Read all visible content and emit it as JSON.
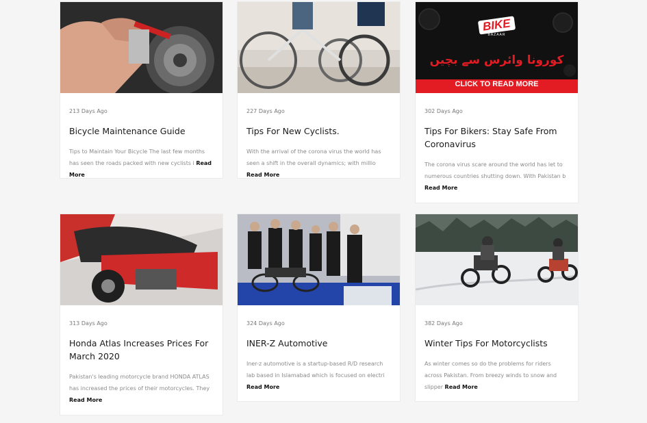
{
  "posts": [
    {
      "days_ago": "213 Days Ago",
      "title": "Bicycle Maintenance Guide",
      "excerpt": "Tips to Maintain Your Bicycle The last few months has seen the roads packed with new cyclists i",
      "read_more": "Read More",
      "image": "bicycle-maintenance-photo"
    },
    {
      "days_ago": "227 Days Ago",
      "title": "Tips For New Cyclists.",
      "excerpt": "With the arrival of the corona virus the world has seen a shift in the overall dynamics; with millio",
      "read_more": "Read More",
      "image": "new-cyclists-photo"
    },
    {
      "days_ago": "302 Days Ago",
      "title": "Tips For Bikers: Stay Safe From Coronavirus",
      "excerpt": "The corona virus scare around the world has let to numerous countries shutting down. With Pakistan b",
      "read_more": "Read More",
      "image": "bike-bazaar-corona-banner",
      "banner": {
        "brand": "BIKE",
        "sub": "BAZAAR",
        "urdu": "کورونا وائرس سے بچیں",
        "cta": "CLICK TO READ MORE"
      }
    },
    {
      "days_ago": "313 Days Ago",
      "title": "Honda Atlas Increases Prices For March 2020",
      "excerpt": "Pakistan's leading motorcycle brand HONDA ATLAS has increased the prices of their motorcycles. They",
      "read_more": "Read More",
      "image": "honda-motorcycle-photo"
    },
    {
      "days_ago": "324 Days Ago",
      "title": "INER-Z Automotive",
      "excerpt": "Iner-z automotive is a startup-based R/D research lab based in Islamabad which is focused on electri",
      "read_more": "Read More",
      "image": "iner-z-team-photo"
    },
    {
      "days_ago": "382 Days Ago",
      "title": "Winter Tips For Motorcyclists",
      "excerpt": "As winter comes so do the problems for riders across Pakistan. From breezy winds to snow and slipper",
      "read_more": "Read More",
      "image": "winter-riders-photo"
    }
  ],
  "colors": {
    "banner_red": "#e31b23",
    "banner_dark": "#111111",
    "page_bg": "#f5f5f5"
  }
}
